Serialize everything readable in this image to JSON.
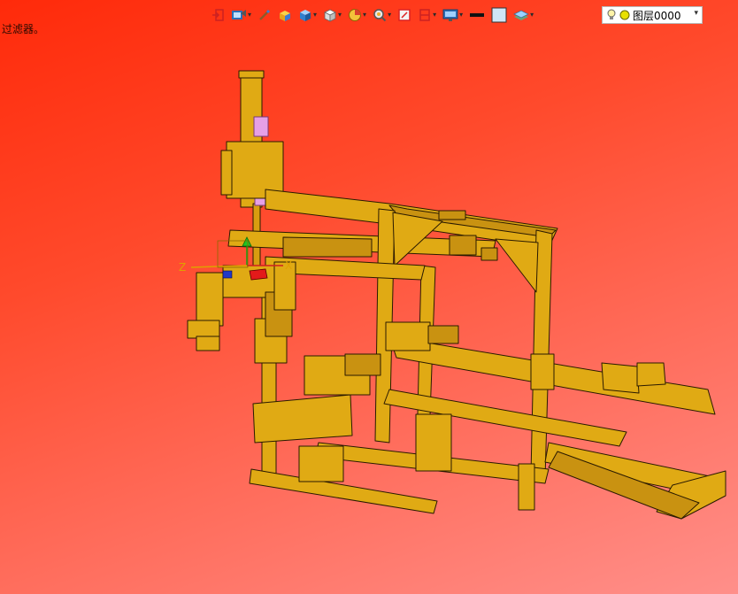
{
  "viewport": {
    "background_top": "#ff2a0a",
    "background_bottom": "#ff8f8a",
    "status_text": "过滤器。"
  },
  "toolbar": {
    "buttons": [
      {
        "name": "exit-sketch-icon",
        "dropdown": false
      },
      {
        "name": "render-mode-icon",
        "dropdown": true
      },
      {
        "name": "brush-icon",
        "dropdown": false
      },
      {
        "name": "solid-box-icon",
        "dropdown": false
      },
      {
        "name": "cube-view-icon",
        "dropdown": true
      },
      {
        "name": "standard-view-icon",
        "dropdown": true
      },
      {
        "name": "pie-section-icon",
        "dropdown": true
      },
      {
        "name": "zoom-icon",
        "dropdown": true
      },
      {
        "name": "fit-view-icon",
        "dropdown": false
      },
      {
        "name": "section-plane-icon",
        "dropdown": true
      },
      {
        "name": "display-settings-icon",
        "dropdown": true
      },
      {
        "name": "line-color-icon",
        "dropdown": false
      },
      {
        "name": "fill-color-icon",
        "dropdown": false
      },
      {
        "name": "layer-stack-icon",
        "dropdown": true
      }
    ],
    "layer_selector": {
      "value": "图层0000",
      "icons": [
        "lightbulb-icon",
        "yellow-dot-icon"
      ]
    }
  },
  "triad": {
    "x_label": "X",
    "z_label": "Z"
  },
  "model": {
    "color": "#e0aa14",
    "edge_color": "#2a1a00"
  }
}
